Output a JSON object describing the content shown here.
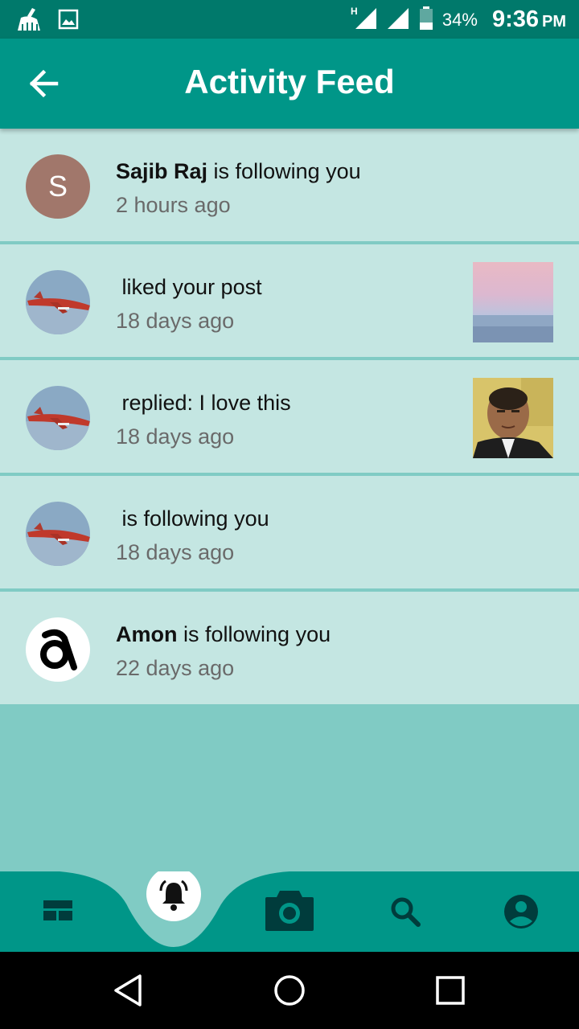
{
  "status_bar": {
    "signal_label": "H",
    "battery": "34%",
    "time": "9:36",
    "ampm": "PM"
  },
  "app_bar": {
    "title": "Activity Feed",
    "back_icon": "arrow-back-icon"
  },
  "feed": [
    {
      "name": "Sajib Raj",
      "action": " is following you",
      "time": "2 hours ago",
      "avatar": "letter",
      "avatar_letter": "S",
      "thumb": "none"
    },
    {
      "name": "",
      "action": " liked your post",
      "time": "18 days ago",
      "avatar": "airplane",
      "avatar_letter": "",
      "thumb": "sea-sunset"
    },
    {
      "name": "",
      "action": " replied: I love this",
      "time": "18 days ago",
      "avatar": "airplane",
      "avatar_letter": "",
      "thumb": "portrait"
    },
    {
      "name": "",
      "action": " is following you",
      "time": "18 days ago",
      "avatar": "airplane",
      "avatar_letter": "",
      "thumb": "none"
    },
    {
      "name": "Amon",
      "action": " is following you",
      "time": "22 days ago",
      "avatar": "ampersand-logo",
      "avatar_letter": "",
      "thumb": "none"
    }
  ],
  "bottom_nav": {
    "items": [
      "timeline-icon",
      "bell-icon",
      "camera-icon",
      "search-icon",
      "account-icon"
    ],
    "active": "bell-icon"
  },
  "colors": {
    "status_bar": "#00796b",
    "app_bar": "#009688",
    "item_bg": "#c4e6e2",
    "page_bg": "#80cbc4",
    "nav_bg": "#009688",
    "nav_icon": "#003c3c"
  }
}
